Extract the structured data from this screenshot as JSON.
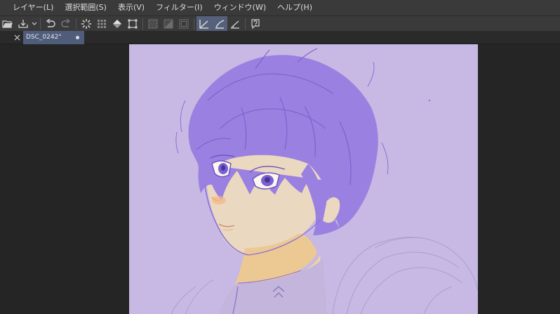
{
  "menubar": {
    "items": [
      "レイヤー(L)",
      "選択範囲(S)",
      "表示(V)",
      "フィルター(I)",
      "ウィンドウ(W)",
      "ヘルプ(H)"
    ]
  },
  "toolbar": {
    "icons": [
      "open-folder-icon",
      "save-icon",
      "dropdown-chevron-icon",
      "undo-icon",
      "redo-icon",
      "loading-spinner-icon",
      "grid-dots-icon",
      "fill-bucket-icon",
      "transform-crop-icon",
      "hatch-pattern-icon",
      "tone-gradient-icon",
      "border-frame-icon",
      "ruler-snap-icon",
      "pen-ruler-icon",
      "ruler-angle-icon",
      "help-icon"
    ]
  },
  "document": {
    "tab_title": "DSC_0242°"
  },
  "colors": {
    "canvas_bg": "#c7b9e3",
    "hair": "#9a80e0",
    "skin": "#ead9c0",
    "active_tool": "#55617a",
    "tab_active": "#4f5d7a"
  }
}
